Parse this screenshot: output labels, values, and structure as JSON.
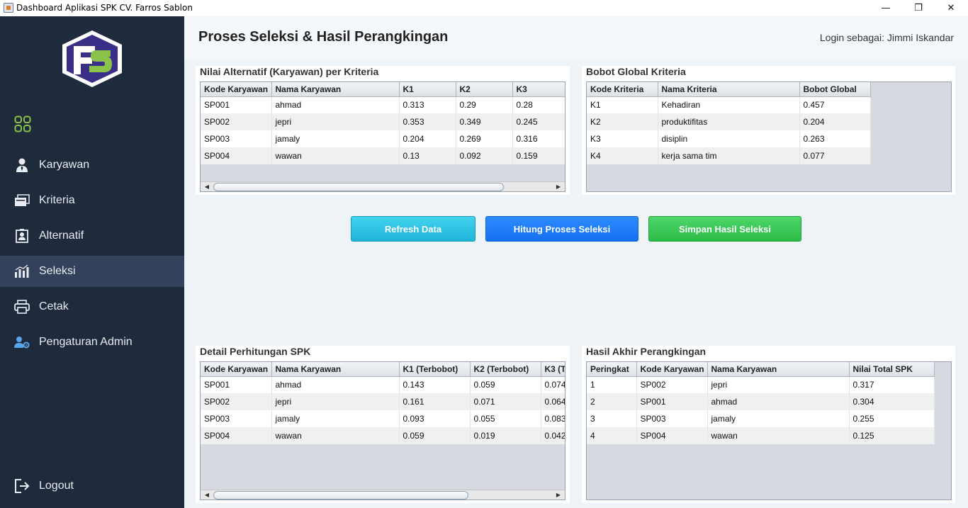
{
  "window": {
    "title": "Dashboard Aplikasi SPK CV. Farros Sablon",
    "minimize": "—",
    "maximize": "❐",
    "close": "✕"
  },
  "sidebar": {
    "items": [
      {
        "label": "Karyawan",
        "icon": "user-icon"
      },
      {
        "label": "Kriteria",
        "icon": "folders-icon"
      },
      {
        "label": "Alternatif",
        "icon": "clipboard-user-icon"
      },
      {
        "label": "Seleksi",
        "icon": "bar-chart-icon",
        "active": true
      },
      {
        "label": "Cetak",
        "icon": "printer-icon"
      },
      {
        "label": "Pengaturan Admin",
        "icon": "user-gear-icon"
      }
    ],
    "logout": "Logout",
    "colors": {
      "background": "#202a3d",
      "active": "#33415a",
      "accent": "#8bc34a"
    }
  },
  "header": {
    "title": "Proses Seleksi & Hasil Perangkingan",
    "login": "Login sebagai: Jimmi Iskandar"
  },
  "nilai_alternatif": {
    "title": "Nilai Alternatif (Karyawan) per Kriteria",
    "columns": [
      "Kode Karyawan",
      "Nama Karyawan",
      "K1",
      "K2",
      "K3"
    ],
    "rows": [
      [
        "SP001",
        "ahmad",
        "0.313",
        "0.29",
        "0.28"
      ],
      [
        "SP002",
        "jepri",
        "0.353",
        "0.349",
        "0.245"
      ],
      [
        "SP003",
        "jamaly",
        "0.204",
        "0.269",
        "0.316"
      ],
      [
        "SP004",
        "wawan",
        "0.13",
        "0.092",
        "0.159"
      ]
    ]
  },
  "bobot_global": {
    "title": "Bobot Global Kriteria",
    "columns": [
      "Kode Kriteria",
      "Nama Kriteria",
      "Bobot Global"
    ],
    "rows": [
      [
        "K1",
        "Kehadiran",
        "0.457"
      ],
      [
        "K2",
        "produktifitas",
        "0.204"
      ],
      [
        "K3",
        "disiplin",
        "0.263"
      ],
      [
        "K4",
        "kerja sama tim",
        "0.077"
      ]
    ]
  },
  "buttons": {
    "refresh": "Refresh Data",
    "hitung": "Hitung Proses Seleksi",
    "simpan": "Simpan Hasil Seleksi"
  },
  "detail_perhitungan": {
    "title": "Detail Perhitungan SPK",
    "columns": [
      "Kode Karyawan",
      "Nama Karyawan",
      "K1 (Terbobot)",
      "K2 (Terbobot)",
      "K3 (T"
    ],
    "rows": [
      [
        "SP001",
        "ahmad",
        "0.143",
        "0.059",
        "0.074"
      ],
      [
        "SP002",
        "jepri",
        "0.161",
        "0.071",
        "0.064"
      ],
      [
        "SP003",
        "jamaly",
        "0.093",
        "0.055",
        "0.083"
      ],
      [
        "SP004",
        "wawan",
        "0.059",
        "0.019",
        "0.042"
      ]
    ]
  },
  "hasil_akhir": {
    "title": "Hasil Akhir Perangkingan",
    "columns": [
      "Peringkat",
      "Kode Karyawan",
      "Nama Karyawan",
      "Nilai Total SPK"
    ],
    "rows": [
      [
        "1",
        "SP002",
        "jepri",
        "0.317"
      ],
      [
        "2",
        "SP001",
        "ahmad",
        "0.304"
      ],
      [
        "3",
        "SP003",
        "jamaly",
        "0.255"
      ],
      [
        "4",
        "SP004",
        "wawan",
        "0.125"
      ]
    ]
  }
}
